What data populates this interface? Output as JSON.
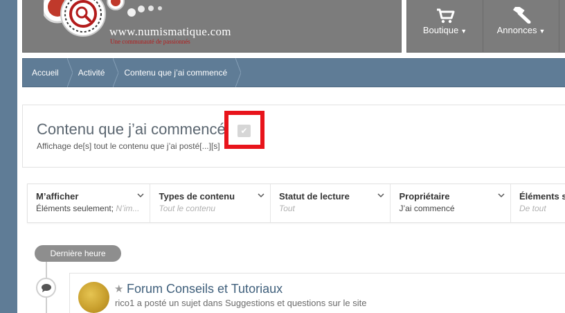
{
  "site": {
    "url_text": "www.numismatique.com",
    "tagline": "Une communauté de passionnés"
  },
  "nav": {
    "items": [
      {
        "label": "Boutique",
        "icon": "cart-icon"
      },
      {
        "label": "Annonces",
        "icon": "gavel-icon"
      }
    ]
  },
  "breadcrumb": {
    "items": [
      "Accueil",
      "Activité",
      "Contenu que j’ai commencé"
    ]
  },
  "page": {
    "title": "Contenu que j’ai commencé",
    "subtitle": "Affichage de[s] tout le contenu que j’ai posté[...][s]"
  },
  "filters": [
    {
      "label": "M’afficher",
      "value": "Éléments seulement;",
      "placeholder": "N’im..."
    },
    {
      "label": "Types de contenu",
      "value": "",
      "placeholder": "Tout le contenu"
    },
    {
      "label": "Statut de lecture",
      "value": "",
      "placeholder": "Tout"
    },
    {
      "label": "Propriétaire",
      "value": "J’ai commencé",
      "placeholder": ""
    },
    {
      "label": "Éléments s",
      "value": "",
      "placeholder": "De tout"
    }
  ],
  "timeline": {
    "group_label": "Dernière heure"
  },
  "activity": {
    "title": "Forum Conseils et Tutoriaux",
    "description": "rico1 a posté un sujet dans Suggestions et questions sur le site"
  },
  "colors": {
    "header_gray": "#7c7c7c",
    "breadcrumb_blue": "#5f7c96",
    "highlight_red": "#e8141b",
    "link_blue": "#3f5f7b"
  }
}
